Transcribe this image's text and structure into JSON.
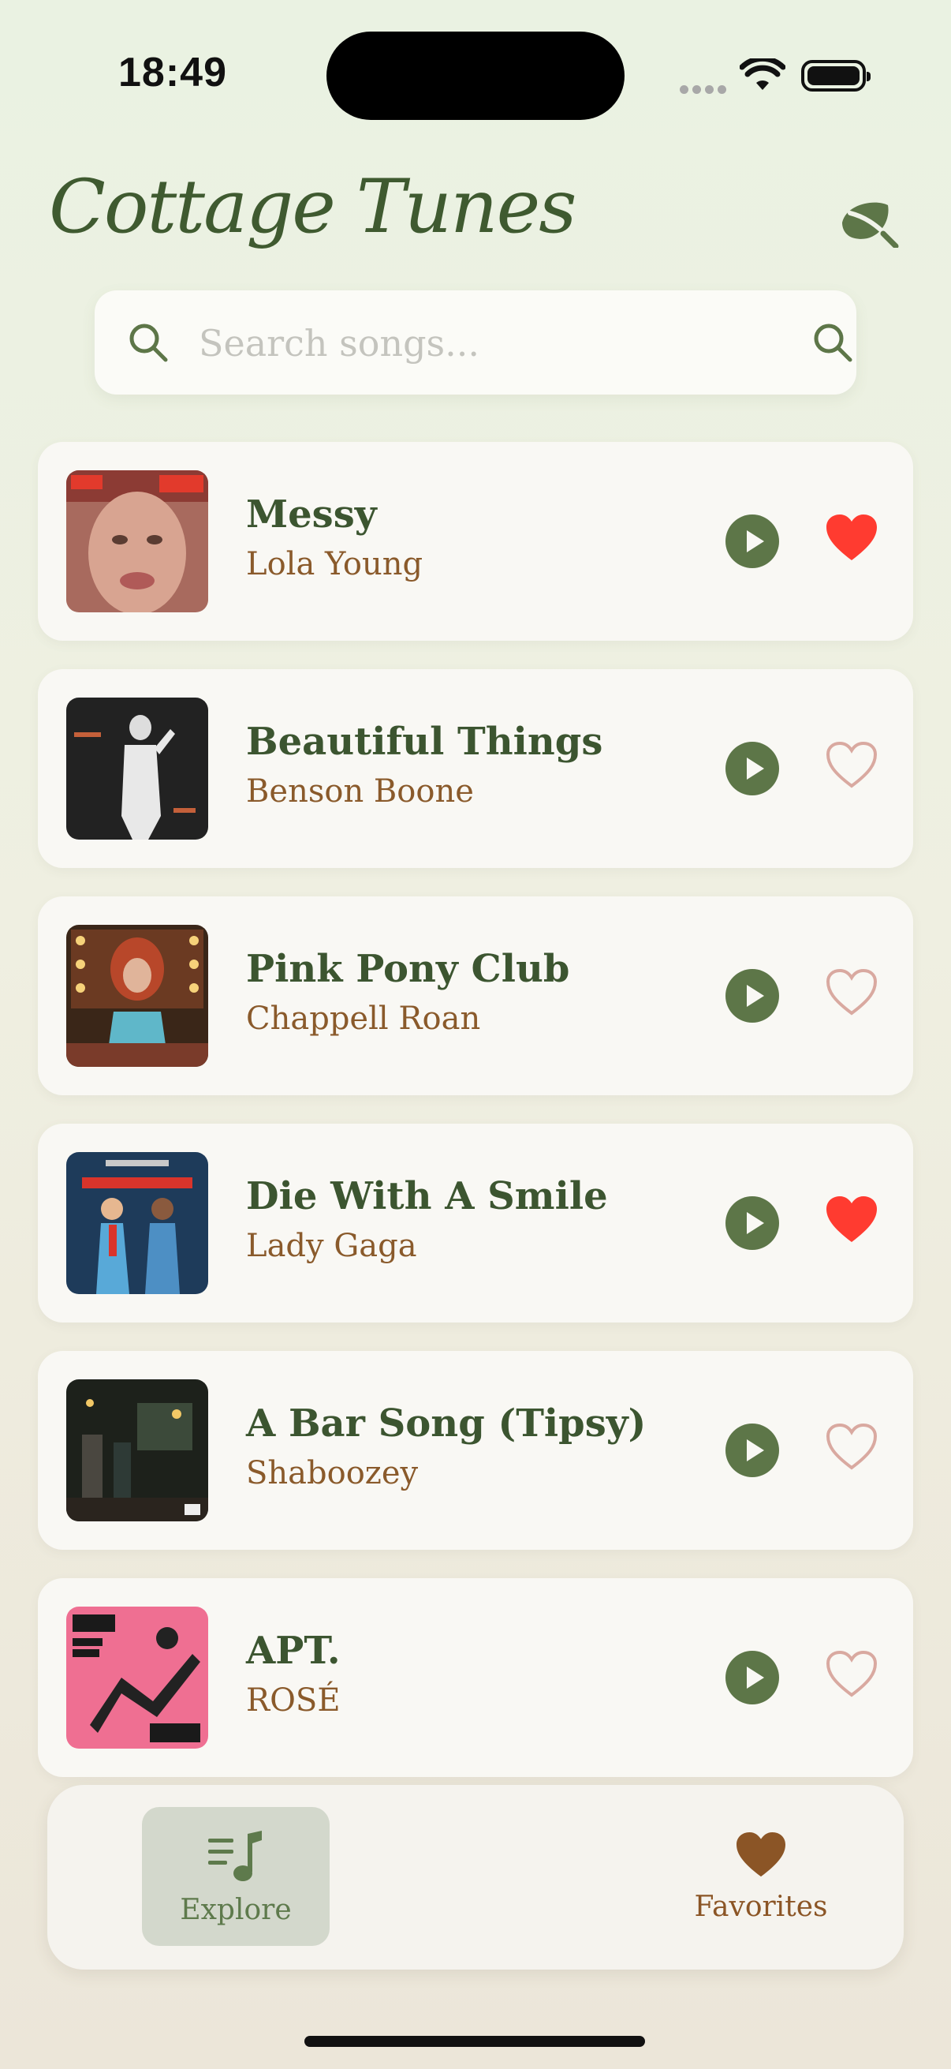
{
  "status_bar": {
    "time": "18:49"
  },
  "app": {
    "title": "Cottage Tunes"
  },
  "search": {
    "placeholder": "Search songs..."
  },
  "songs": [
    {
      "title": "Messy",
      "artist": "Lola Young",
      "favorite": true
    },
    {
      "title": "Beautiful Things",
      "artist": "Benson Boone",
      "favorite": false
    },
    {
      "title": "Pink Pony Club",
      "artist": "Chappell Roan",
      "favorite": false
    },
    {
      "title": "Die With A Smile",
      "artist": "Lady Gaga",
      "favorite": true
    },
    {
      "title": "A Bar Song (Tipsy)",
      "artist": "Shaboozey",
      "favorite": false
    },
    {
      "title": "APT.",
      "artist": "ROSÉ",
      "favorite": false
    }
  ],
  "tabs": {
    "explore": "Explore",
    "favorites": "Favorites"
  },
  "colors": {
    "accent_green": "#5d7648",
    "title_green": "#3f5a30",
    "brown": "#8a5a2b",
    "heart_red": "#ff3b30",
    "heart_outline": "#d9a9a0"
  },
  "icons": {
    "search": "search-icon",
    "leaf": "leaf-icon",
    "play": "play-icon",
    "heart": "heart-icon",
    "music_list": "music-list-icon"
  }
}
